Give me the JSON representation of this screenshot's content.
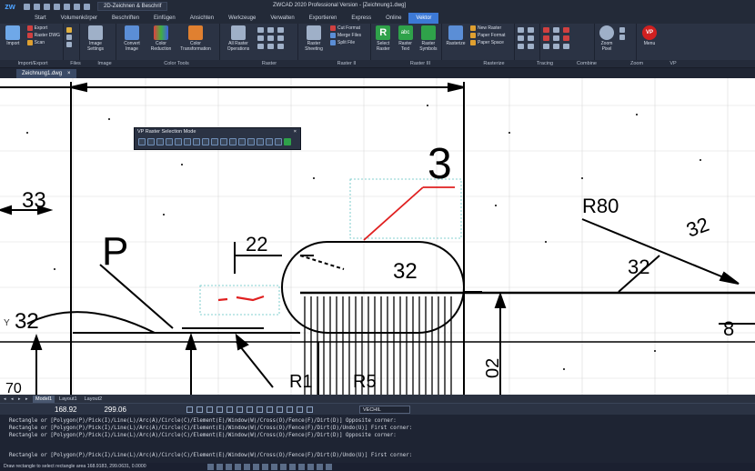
{
  "title_bar": {
    "logo": "zw",
    "workspace": "2D-Zeichnen & Beschrif",
    "app_title": "ZWCAD 2020 Professional Version - [Zeichnung1.dwg]"
  },
  "menu_tabs": [
    "Start",
    "Volumenkörper",
    "Beschriften",
    "Einfügen",
    "Ansichten",
    "Werkzeuge",
    "Verwalten",
    "Exportieren",
    "Express",
    "Online",
    "Vektor"
  ],
  "active_tab": "Vektor",
  "ribbon": {
    "import_export": {
      "import": "Import",
      "export": "Export",
      "raster_dwg": "Raster DWG",
      "scan": "Scan"
    },
    "image": {
      "settings": "Image Settings"
    },
    "color_tools": {
      "convert": "Convert Image",
      "color_reduction": "Color Reduction",
      "color_transformation": "Color Transformation"
    },
    "raster": {
      "all_raster": "All Raster Operations"
    },
    "raster_ii": {
      "sheeting": "Raster Sheeting",
      "cut_format": "Cut Format",
      "merge_files": "Merge Files",
      "split_file": "Split File"
    },
    "raster_iii": {
      "select": "Select Raster",
      "text": "Raster Text",
      "symbols": "Raster Symbols"
    },
    "rasterize": {
      "rasterize": "Rasterize",
      "new_raster": "New Raster",
      "paper_format": "Paper Format",
      "paper_space": "Paper Space"
    },
    "zoom": {
      "zoom_pixel": "Zoom Pixel"
    },
    "vp": {
      "menu": "Menu"
    }
  },
  "ribbon_panels": [
    "Import/Export",
    "Files",
    "Image",
    "Color Tools",
    "Raster",
    "Raster II",
    "Raster III",
    "Rasterize",
    "Tracing",
    "Combine",
    "Zoom",
    "VP"
  ],
  "doc_tab": "Zeichnung1.dwg",
  "vp_toolbar": {
    "title": "VP Raster Selection Mode"
  },
  "drawing_labels": {
    "dim_33": "33",
    "dim_p": "P",
    "dim_22": "22",
    "dim_3": "3",
    "dim_r80": "R80",
    "dim_32a": "32",
    "dim_32b": "32",
    "dim_32c": "32",
    "dim_32d": "32",
    "dim_8": "8",
    "dim_r1": "R1",
    "dim_r5": "R5",
    "dim_02": "02",
    "dim_70": "70",
    "dim_y": "Y"
  },
  "layout_tabs": [
    "Model1",
    "Layout1",
    "Layout2"
  ],
  "active_layout": "Model1",
  "status": {
    "x": "168.92",
    "y": "299.06",
    "layer": "VECHIL"
  },
  "command_lines": [
    "Rectangle or [Polygon(P)/Pick(I)/Line(L)/Arc(A)/Circle(C)/Element(E)/Window(W)/Cross(O)/Fence(F)/Dirt(D)] Opposite corner:",
    "Rectangle or [Polygon(P)/Pick(I)/Line(L)/Arc(A)/Circle(C)/Element(E)/Window(W)/Cross(O)/Fence(F)/Dirt(D)/Undo(U)] First corner:",
    "Rectangle or [Polygon(P)/Pick(I)/Line(L)/Arc(A)/Circle(C)/Element(E)/Window(W)/Cross(O)/Fence(F)/Dirt(D)] Opposite corner:"
  ],
  "command_current": "Rectangle or [Polygon(P)/Pick(I)/Line(L)/Arc(A)/Circle(C)/Element(E)/Window(W)/Cross(O)/Fence(F)/Dirt(D)/Undo(U)] First corner:",
  "bottom_status": "Draw rectangle to select rectangle area  168.9183, 299.0631, 0.0000",
  "colors": {
    "accent": "#3c79d6",
    "background": "#1c2230",
    "ribbon": "#2b3344",
    "selection": "#5ec2c2",
    "stroke_red": "#e02020"
  }
}
